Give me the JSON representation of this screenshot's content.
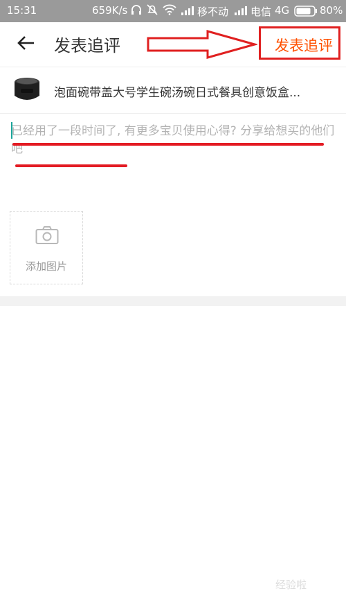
{
  "status_bar": {
    "time": "15:31",
    "speed": "659K/s",
    "carrier1": "移不动",
    "carrier2": "电信",
    "network": "4G",
    "battery": "80%"
  },
  "nav": {
    "title": "发表追评",
    "submit_label": "发表追评"
  },
  "product": {
    "title": "泡面碗带盖大号学生碗汤碗日式餐具创意饭盒..."
  },
  "review": {
    "placeholder": "已经用了一段时间了, 有更多宝贝使用心得? 分享给想买的他们吧"
  },
  "photo": {
    "add_label": "添加图片"
  },
  "colors": {
    "accent": "#ff5000",
    "annotation": "#e31b23",
    "status_bar": "#9a9a9a"
  },
  "watermark": "经验啦"
}
